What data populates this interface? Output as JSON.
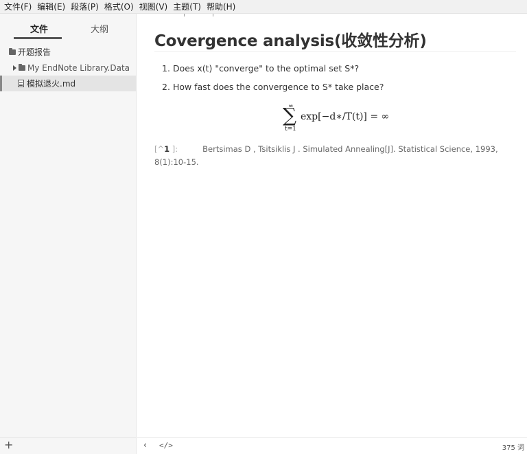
{
  "menubar": {
    "items": [
      "文件(F)",
      "编辑(E)",
      "段落(P)",
      "格式(O)",
      "视图(V)",
      "主题(T)",
      "帮助(H)"
    ]
  },
  "sidebar": {
    "tabs": {
      "files": "文件",
      "outline": "大纲"
    },
    "tree": {
      "root_folder": "开题报告",
      "subfolder": "My EndNote Library.Data",
      "file": "模拟退火.md"
    },
    "footer": {
      "add_label": "+"
    }
  },
  "editor": {
    "title": "Covergence analysis(收敛性分析)",
    "list": [
      {
        "num": "1.",
        "text": "Does x(t) \"converge\" to the optimal set S*?"
      },
      {
        "num": "2.",
        "text": "How fast does the convergence to S* take place?"
      }
    ],
    "math": {
      "upper": "∞",
      "operator": "∑",
      "lower": "t=1",
      "expression": "exp[−d∗/T(t)] = ∞"
    },
    "footnote": {
      "ref_open": "[^",
      "ref_num": "1",
      "ref_close": "]:",
      "text": "Bertsimas D ,  Tsitsiklis J . Simulated Annealing[J]. Statistical Science, 1993, 8(1):10-15."
    }
  },
  "statusbar": {
    "back_icon": "‹",
    "code_icon": "</>",
    "word_count": "375 词"
  }
}
